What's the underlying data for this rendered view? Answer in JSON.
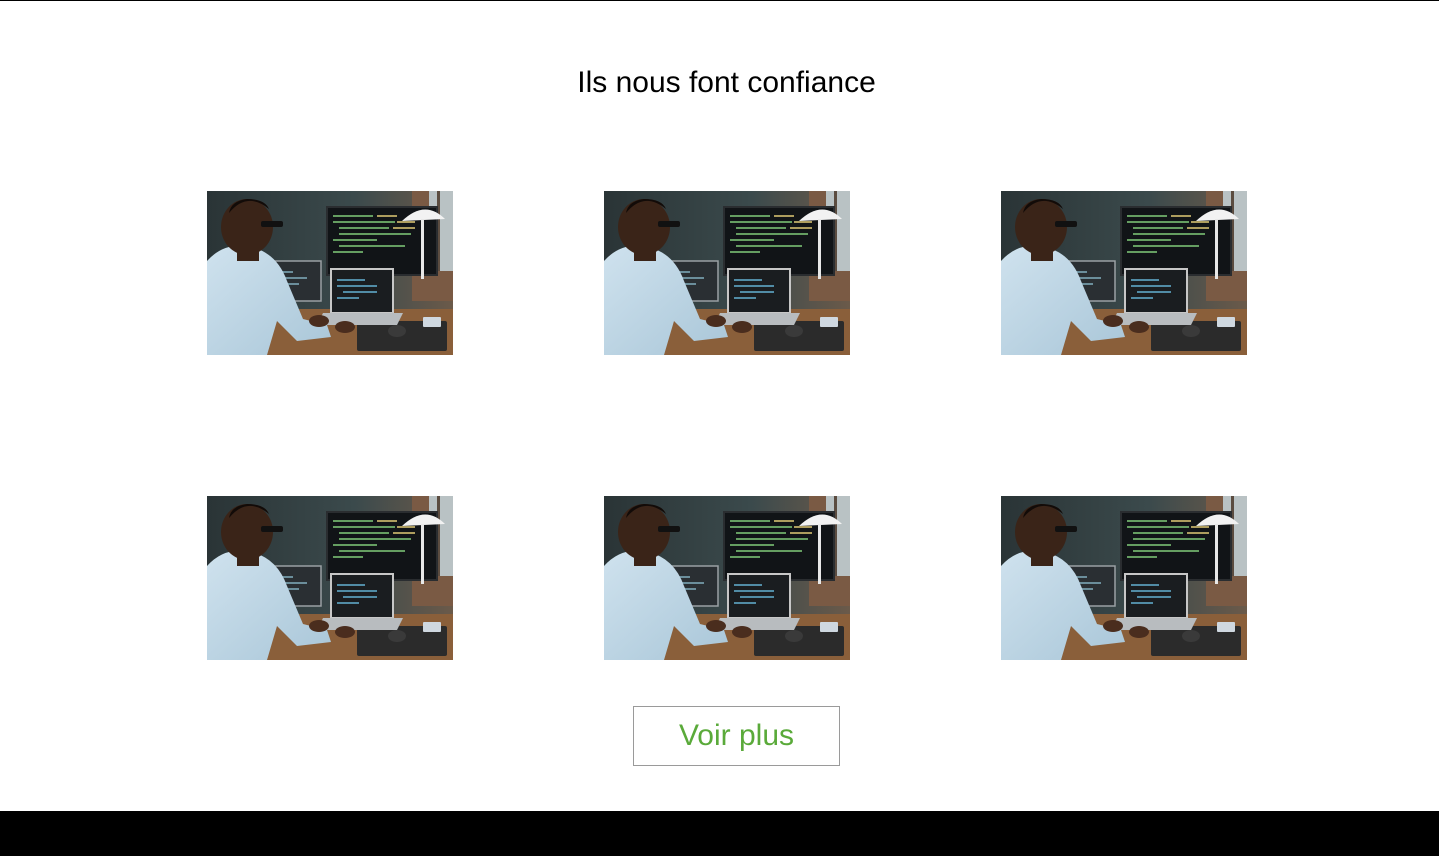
{
  "section": {
    "title": "Ils nous font confiance"
  },
  "gallery": {
    "items": [
      {
        "icon": "developer-workspace-photo"
      },
      {
        "icon": "developer-workspace-photo"
      },
      {
        "icon": "developer-workspace-photo"
      },
      {
        "icon": "developer-workspace-photo"
      },
      {
        "icon": "developer-workspace-photo"
      },
      {
        "icon": "developer-workspace-photo"
      }
    ]
  },
  "actions": {
    "more_label": "Voir plus"
  },
  "colors": {
    "accent_text": "#5aaa3a",
    "footer_bg": "#000000",
    "button_border": "#9a9a9a"
  }
}
